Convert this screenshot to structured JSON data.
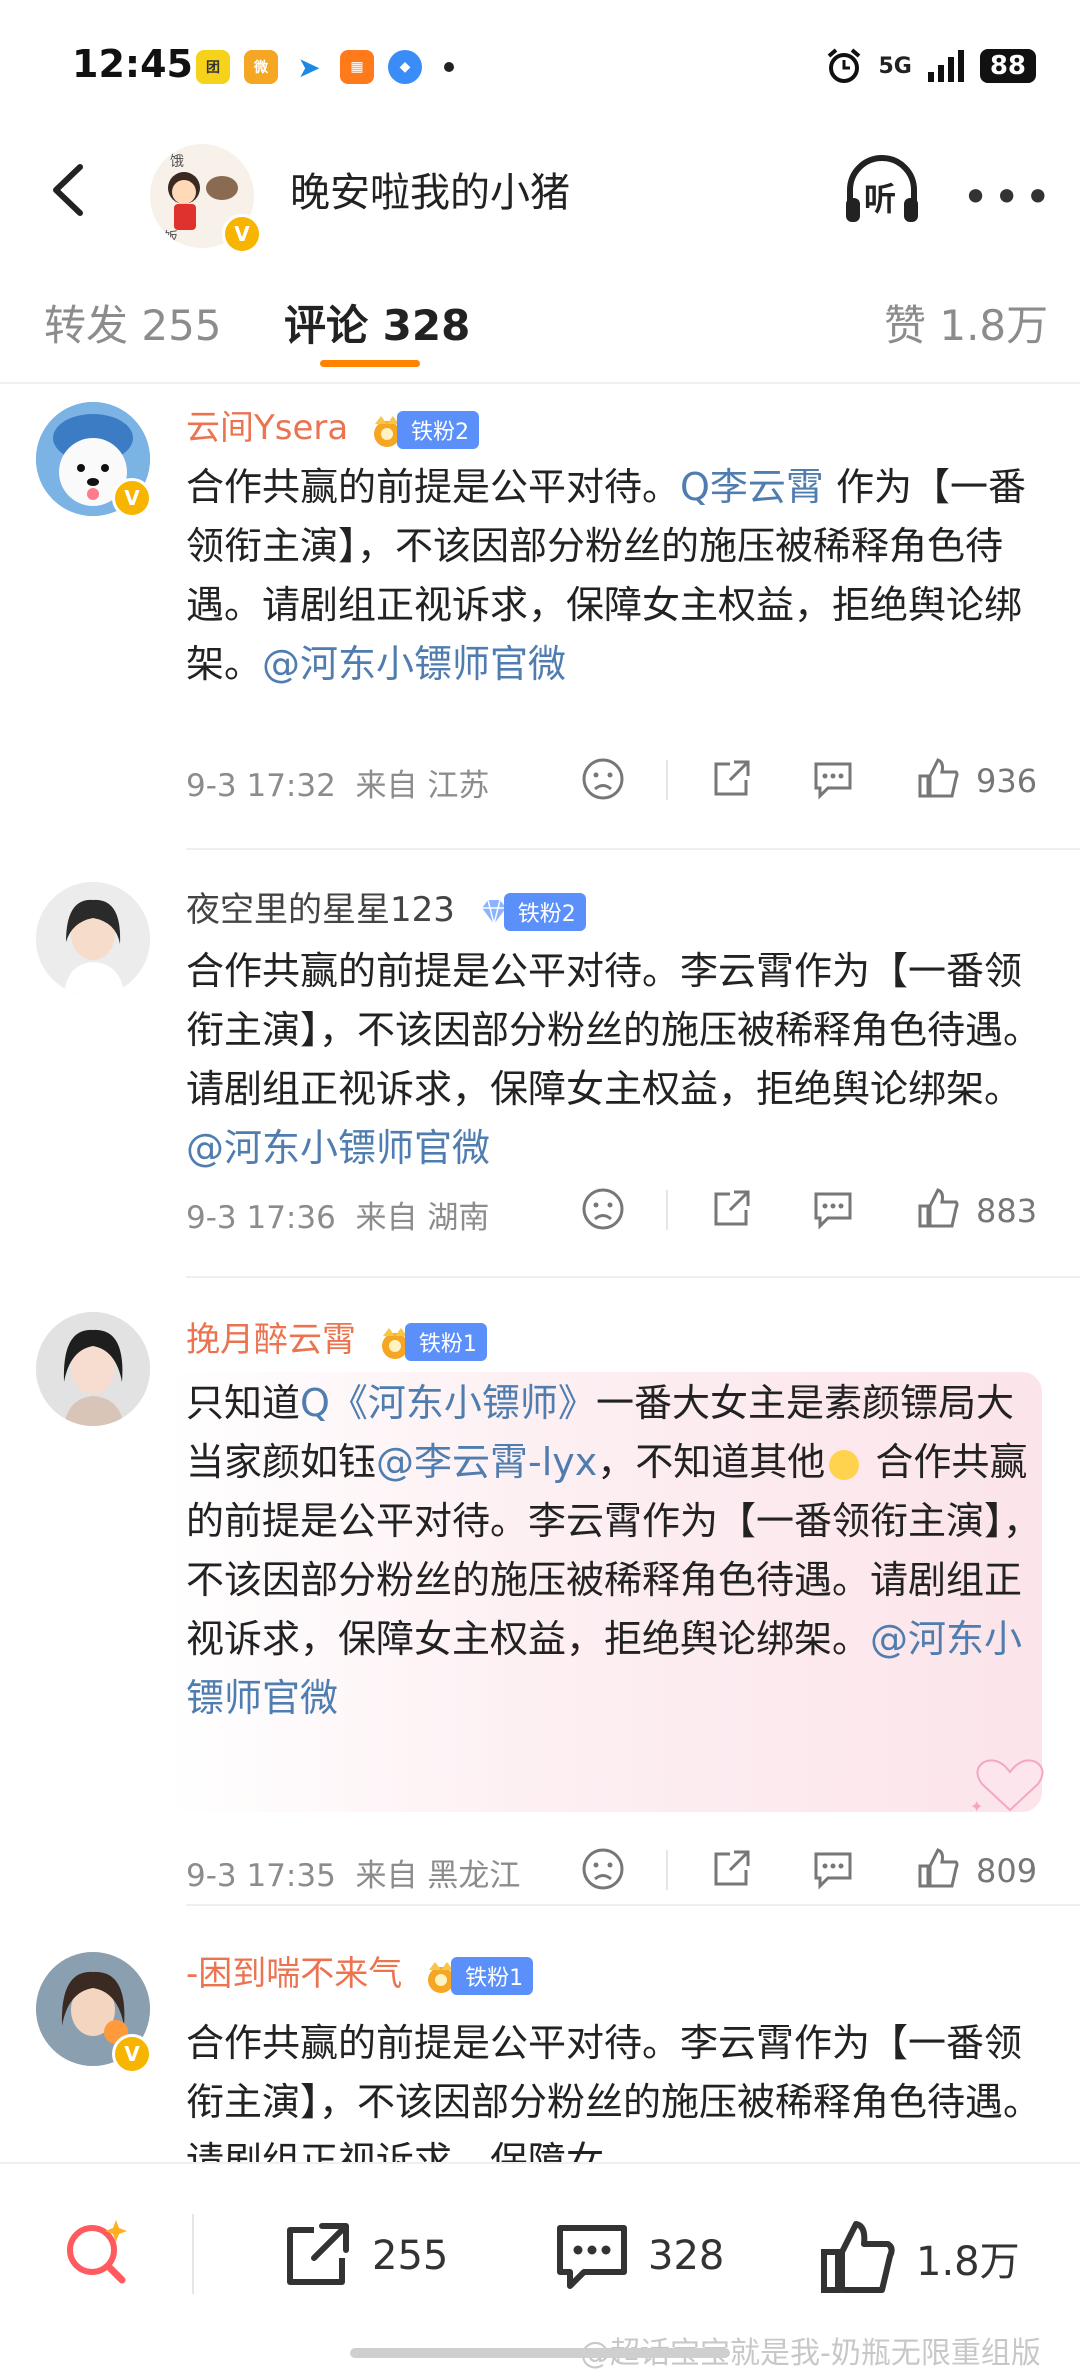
{
  "status_bar": {
    "time": "12:45",
    "network": "5G",
    "battery": "88"
  },
  "header": {
    "title": "晚安啦我的小猪",
    "listen_label": "听"
  },
  "tabs": [
    {
      "label": "转发 255"
    },
    {
      "label": "评论 328"
    },
    {
      "label": "赞 1.8万"
    }
  ],
  "comments": [
    {
      "user": "云间Ysera",
      "fan_level": "铁粉2",
      "text_parts": [
        "合作共赢的前提是公平对待。",
        "Q李云霄",
        " 作为【一番领衔主演】，不该因部分粉丝的施压被稀释角色待遇。请剧组正视诉求，保障女主权益，拒绝舆论绑架。",
        "@河东小镖师官微"
      ],
      "time": "9-3 17:32",
      "location": "来自 江苏",
      "likes": "936"
    },
    {
      "user": "夜空里的星星123",
      "fan_level": "铁粉2",
      "text_parts": [
        "合作共赢的前提是公平对待。李云霄作为【一番领衔主演】，不该因部分粉丝的施压被稀释角色待遇。请剧组正视诉求，保障女主权益，拒绝舆论绑架。",
        "@河东小镖师官微"
      ],
      "time": "9-3 17:36",
      "location": "来自 湖南",
      "likes": "883"
    },
    {
      "user": "挽月醉云霄",
      "fan_level": "铁粉1",
      "text_parts": [
        "只知道",
        "Q《河东小镖师》",
        "一番大女主是素颜镖局大当家颜如钰",
        "@李云霄-lyx",
        "，不知道其他",
        " 合作共赢的前提是公平对待。李云霄作为【一番领衔主演】，不该因部分粉丝的施压被稀释角色待遇。请剧组正视诉求，保障女主权益，拒绝舆论绑架。",
        "@河东小镖师官微"
      ],
      "time": "9-3 17:35",
      "location": "来自 黑龙江",
      "likes": "809"
    },
    {
      "user": "-困到喘不来气",
      "fan_level": "铁粉1",
      "text_parts": [
        "合作共赢的前提是公平对待。李云霄作为【一番领衔主演】，不该因部分粉丝的施压被稀释角色待遇。请剧组正视诉求，保障女"
      ],
      "time": "",
      "location": "",
      "likes": ""
    }
  ],
  "bottom_bar": {
    "repost_count": "255",
    "comment_count": "328",
    "like_count": "1.8万"
  },
  "watermark": "@超话宝宝就是我-奶瓶无限重组版",
  "colors": {
    "accent": "#ff8200",
    "link": "#507daf",
    "username": "#eb7350",
    "fan_badge": "#5b8ff9"
  }
}
